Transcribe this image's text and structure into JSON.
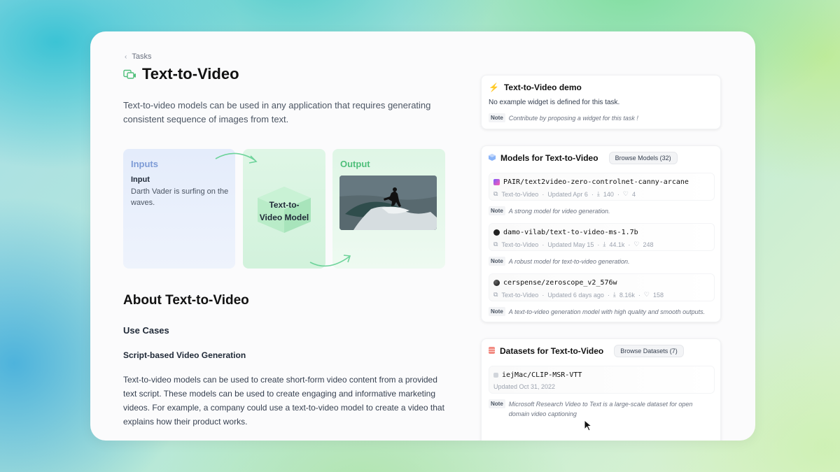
{
  "breadcrumb": {
    "label": "Tasks"
  },
  "page": {
    "title": "Text-to-Video",
    "description": "Text-to-video models can be used in any application that requires generating consistent sequence of images from text."
  },
  "diagram": {
    "inputs_heading": "Inputs",
    "input_label": "Input",
    "input_value": "Darth Vader is surfing on the waves.",
    "model_label_1": "Text-to-",
    "model_label_2": "Video Model",
    "output_heading": "Output"
  },
  "about": {
    "heading": "About Text-to-Video",
    "use_cases": "Use Cases",
    "subheading": "Script-based Video Generation",
    "body": "Text-to-video models can be used to create short-form video content from a provided text script. These models can be used to create engaging and informative marketing videos. For example, a company could use a text-to-video model to create a video that explains how their product works."
  },
  "demo": {
    "title": "Text-to-Video demo",
    "message": "No example widget is defined for this task.",
    "note_tag": "Note",
    "note": "Contribute by proposing a widget for this task !"
  },
  "models": {
    "title": "Models for Text-to-Video",
    "browse": "Browse Models (32)",
    "items": [
      {
        "name": "PAIR/text2video-zero-controlnet-canny-arcane",
        "task": "Text-to-Video",
        "updated": "Updated Apr 6",
        "downloads": "140",
        "likes": "4",
        "note": "A strong model for video generation.",
        "color": "#7c5cff"
      },
      {
        "name": "damo-vilab/text-to-video-ms-1.7b",
        "task": "Text-to-Video",
        "updated": "Updated May 15",
        "downloads": "44.1k",
        "likes": "248",
        "note": "A robust model for text-to-video generation.",
        "color": "#222222"
      },
      {
        "name": "cerspense/zeroscope_v2_576w",
        "task": "Text-to-Video",
        "updated": "Updated 6 days ago",
        "downloads": "8.16k",
        "likes": "158",
        "note": "A text-to-video generation model with high quality and smooth outputs.",
        "color": "#111111"
      }
    ]
  },
  "datasets": {
    "title": "Datasets for Text-to-Video",
    "browse": "Browse Datasets (7)",
    "items": [
      {
        "name": "iejMac/CLIP-MSR-VTT",
        "updated": "Updated Oct 31, 2022",
        "note": "Microsoft Research Video to Text is a large-scale dataset for open domain video captioning"
      }
    ]
  },
  "note_tag": "Note"
}
